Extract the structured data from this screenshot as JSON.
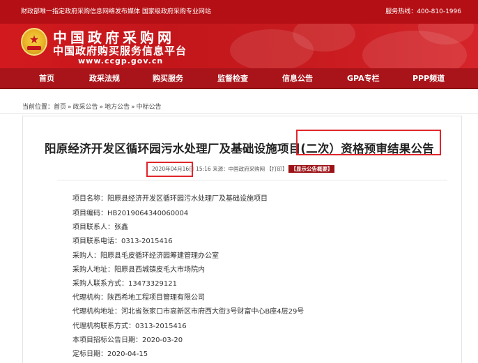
{
  "topbar": {
    "left_text": "财政部唯一指定政府采购信息网络发布媒体 国家级政府采购专业网站",
    "hotline_label": "服务热线：",
    "hotline_number": "400-810-1996"
  },
  "banner": {
    "logo_line1": "中国政府采购网",
    "logo_line2": "中国政府购买服务信息平台",
    "logo_url": "www.ccgp.gov.cn"
  },
  "nav": {
    "items": [
      "首页",
      "政采法规",
      "购买服务",
      "监督检查",
      "信息公告",
      "GPA专栏",
      "PPP频道"
    ]
  },
  "breadcrumb": {
    "label": "当前位置：",
    "items": [
      "首页",
      "政采公告",
      "地方公告",
      "中标公告"
    ],
    "separator": "»"
  },
  "article": {
    "title": "阳原经济开发区循环园污水处理厂及基础设施项目(二次）资格预审结果公告",
    "meta": {
      "date": "2020年04月16日",
      "time": "15:16",
      "source": "来源：中国政府采购网",
      "print": "【打印】",
      "summary_badge": "【显示公告概要】"
    },
    "fields": [
      {
        "label": "项目名称：",
        "value": "阳原县经济开发区循环园污水处理厂及基础设施项目"
      },
      {
        "label": "项目编码：",
        "value": "HB2019064340060004"
      },
      {
        "label": "项目联系人：",
        "value": "张鑫"
      },
      {
        "label": "项目联系电话：",
        "value": "0313-2015416"
      },
      {
        "label": "采购人：",
        "value": "阳原县毛皮循环经济园筹建管理办公室"
      },
      {
        "label": "采购人地址：",
        "value": "阳原县西城镇皮毛大市场院内"
      },
      {
        "label": "采购人联系方式：",
        "value": "13473329121"
      },
      {
        "label": "代理机构：",
        "value": "陕西希地工程项目管理有限公司"
      },
      {
        "label": "代理机构地址：",
        "value": "河北省张家口市高新区市府西大街3号财富中心B座4层29号"
      },
      {
        "label": "代理机构联系方式：",
        "value": "0313-2015416"
      },
      {
        "label": "本项目招标公告日期：",
        "value": "2020-03-20"
      },
      {
        "label": "定标日期：",
        "value": "2020-04-15"
      }
    ]
  }
}
